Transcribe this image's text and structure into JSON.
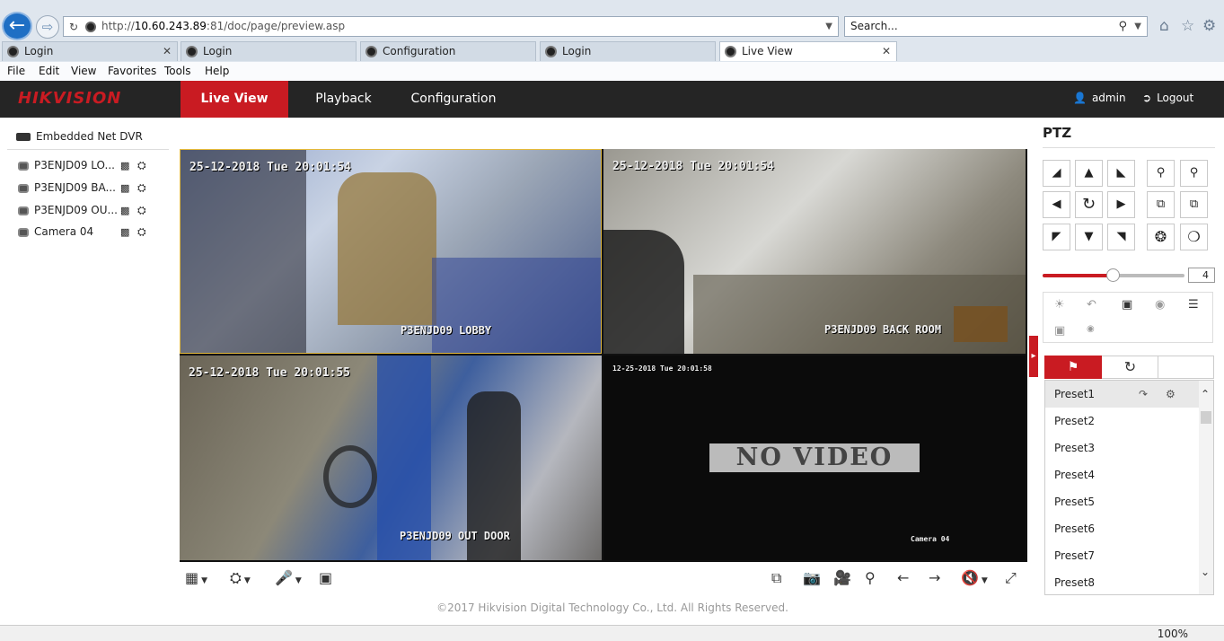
{
  "browser": {
    "url_prefix": "http://",
    "url_host": "10.60.243.89",
    "url_rest": ":81/doc/page/preview.asp",
    "search_placeholder": "Search...",
    "tabs": [
      {
        "label": "Login"
      },
      {
        "label": "Login"
      },
      {
        "label": "Configuration"
      },
      {
        "label": "Login"
      },
      {
        "label": "Live View"
      }
    ],
    "menu": [
      "File",
      "Edit",
      "View",
      "Favorites",
      "Tools",
      "Help"
    ],
    "zoom": "100%"
  },
  "header": {
    "logo": "HIKVISION",
    "nav": {
      "live": "Live View",
      "playback": "Playback",
      "config": "Configuration"
    },
    "user": "admin",
    "logout": "Logout",
    "accent_color": "#c91b22"
  },
  "tree": {
    "root": "Embedded Net DVR",
    "cameras": [
      "P3ENJD09 LO...",
      "P3ENJD09 BA...",
      "P3ENJD09 OU...",
      "Camera 04"
    ]
  },
  "video": {
    "tiles": [
      {
        "timestamp": "25-12-2018 Tue 20:01:54",
        "label": "P3ENJD09 LOBBY"
      },
      {
        "timestamp": "25-12-2018 Tue 20:01:54",
        "label": "P3ENJD09 BACK ROOM"
      },
      {
        "timestamp": "25-12-2018 Tue 20:01:55",
        "label": "P3ENJD09 OUT DOOR"
      },
      {
        "timestamp": "12-25-2018 Tue 20:01:58",
        "label": "Camera 04",
        "status": "NO VIDEO"
      }
    ]
  },
  "footer": {
    "copyright": "©2017 Hikvision Digital Technology Co., Ltd. All Rights Reserved."
  },
  "ptz": {
    "title": "PTZ",
    "speed": "4",
    "presets": [
      "Preset1",
      "Preset2",
      "Preset3",
      "Preset4",
      "Preset5",
      "Preset6",
      "Preset7",
      "Preset8"
    ]
  }
}
